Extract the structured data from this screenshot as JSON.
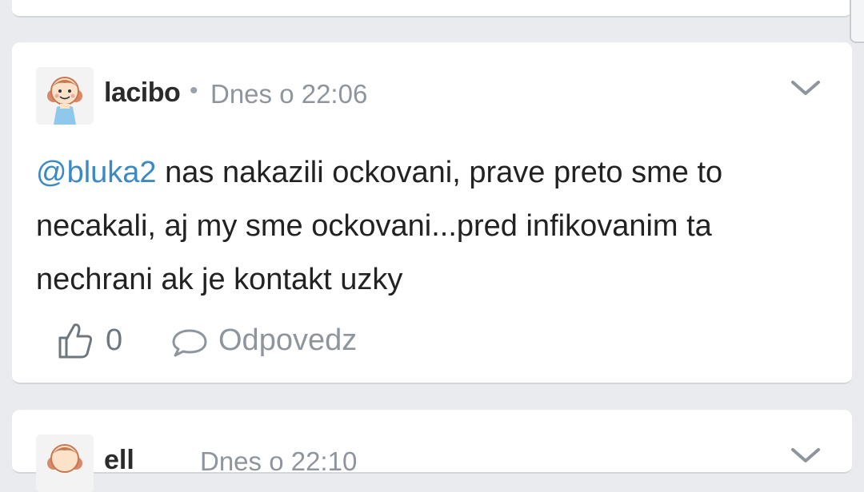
{
  "comment": {
    "username": "lacibo",
    "separator": "•",
    "timestamp": "Dnes o 22:06",
    "mention": "@bluka2",
    "text": " nas nakazili ockovani, prave preto sme to necakali, aj my sme ockovani...pred infikovanim ta nechrani ak je kontakt uzky",
    "like_count": "0",
    "reply_label": "Odpovedz",
    "icons": [
      "chevron-down-icon",
      "thumbs-up-icon",
      "speech-bubble-icon"
    ]
  },
  "next_comment": {
    "username_partial": "ell",
    "timestamp_partial": "Dnes o 22:10"
  },
  "colors": {
    "mention": "#3b8ac4",
    "background": "#e9ebee",
    "card": "#ffffff",
    "meta": "#8e959d"
  }
}
